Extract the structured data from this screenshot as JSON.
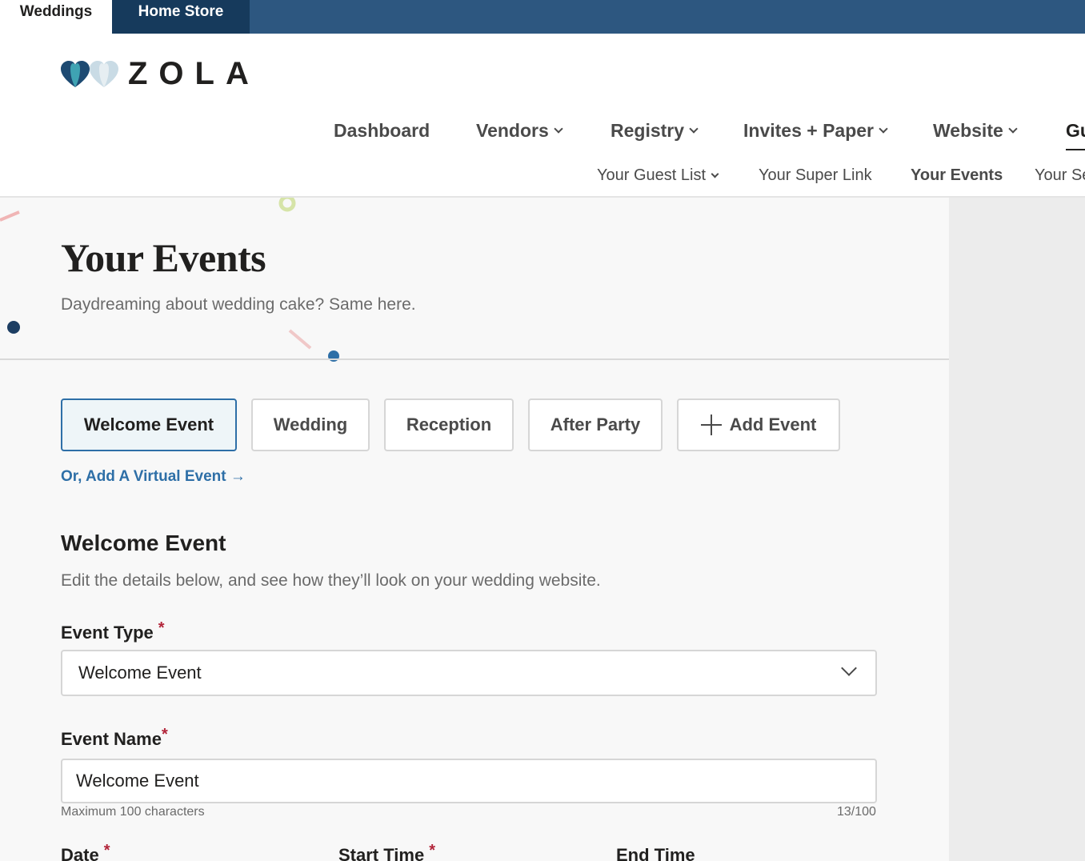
{
  "topbar": {
    "tabs": [
      {
        "label": "Weddings",
        "active": true
      },
      {
        "label": "Home Store",
        "active": false
      }
    ],
    "bg_color": "#2d5780"
  },
  "logo": {
    "text": "ZOLA",
    "icon": "zola-hearts-logo"
  },
  "main_nav": {
    "items": [
      {
        "label": "Dashboard",
        "has_dropdown": false
      },
      {
        "label": "Vendors",
        "has_dropdown": true
      },
      {
        "label": "Registry",
        "has_dropdown": true
      },
      {
        "label": "Invites + Paper",
        "has_dropdown": true
      },
      {
        "label": "Website",
        "has_dropdown": true
      },
      {
        "label": "Gu",
        "has_dropdown": false
      }
    ]
  },
  "sub_nav": {
    "items": [
      {
        "label": "Your Guest List",
        "has_dropdown": true
      },
      {
        "label": "Your Super Link",
        "has_dropdown": false
      },
      {
        "label": "Your Events",
        "active": true
      },
      {
        "label": "Your Se",
        "has_dropdown": false
      }
    ]
  },
  "page": {
    "title": "Your Events",
    "subtitle": "Daydreaming about wedding cake? Same here."
  },
  "event_tabs": {
    "items": [
      "Welcome Event",
      "Wedding",
      "Reception",
      "After Party"
    ],
    "selected": "Welcome Event",
    "add_label": "Add Event"
  },
  "virtual_link": {
    "label": "Or, Add A Virtual Event",
    "arrow": "→"
  },
  "section": {
    "title": "Welcome Event",
    "subtitle": "Edit the details below, and see how they’ll look on your wedding website."
  },
  "form": {
    "required_marker": "*",
    "event_type": {
      "label": "Event Type",
      "value": "Welcome Event"
    },
    "event_name": {
      "label": "Event Name",
      "value": "Welcome Event",
      "helper": "Maximum 100 characters",
      "counter": "13/100"
    },
    "date": {
      "label": "Date"
    },
    "start_time": {
      "label": "Start Time"
    },
    "end_time": {
      "label": "End Time"
    }
  },
  "colors": {
    "accent_blue": "#2e6fa7",
    "required_red": "#b2253a",
    "navy": "#163a5c"
  }
}
